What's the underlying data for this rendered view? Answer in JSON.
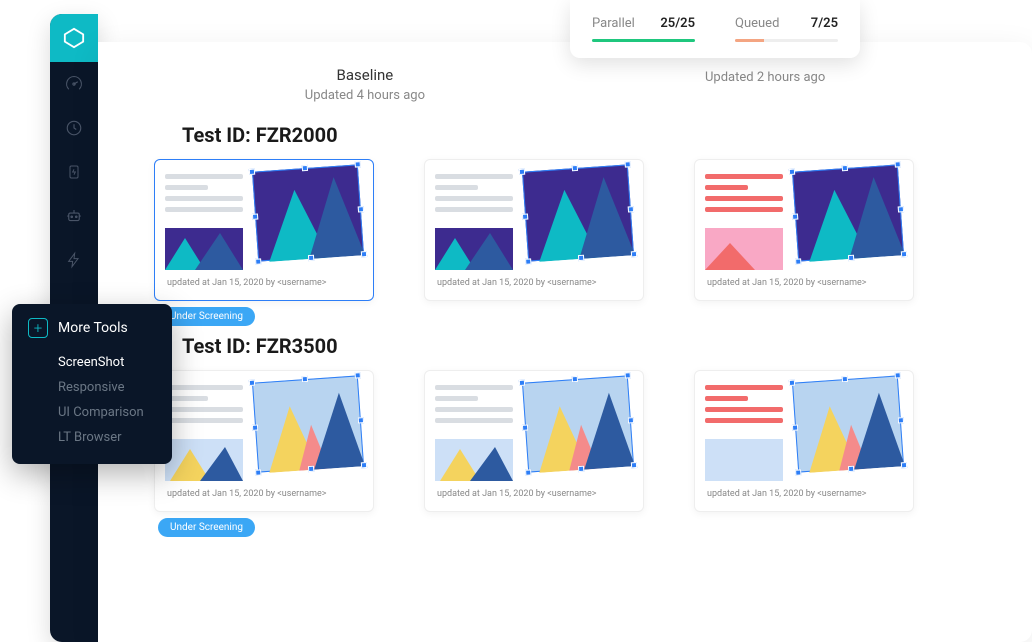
{
  "header": {
    "baseline": {
      "title": "Baseline",
      "subtitle": "Updated 4 hours ago"
    },
    "compare": {
      "subtitle": "Updated 2 hours ago"
    }
  },
  "status": {
    "parallel": {
      "label": "Parallel",
      "value": "25/25"
    },
    "queued": {
      "label": "Queued",
      "value": "7/25"
    }
  },
  "tests": [
    {
      "id": "FZR2000",
      "title": "Test ID: FZR2000",
      "badge": "Under Screening",
      "cards": [
        {
          "footer": "updated at Jan 15, 2020 by <username>",
          "selected": true,
          "variant": "dark_purple"
        },
        {
          "footer": "updated at Jan 15, 2020 by <username>",
          "selected": false,
          "variant": "dark_purple"
        },
        {
          "footer": "updated at Jan 15, 2020 by <username>",
          "selected": false,
          "variant": "red_pink"
        }
      ]
    },
    {
      "id": "FZR3500",
      "title": "Test ID: FZR3500",
      "badge": "Under Screening",
      "cards": [
        {
          "footer": "updated at Jan 15, 2020 by <username>",
          "selected": false,
          "variant": "light"
        },
        {
          "footer": "updated at Jan 15, 2020 by <username>",
          "selected": false,
          "variant": "light"
        },
        {
          "footer": "updated at Jan 15, 2020 by <username>",
          "selected": false,
          "variant": "red_light"
        }
      ]
    }
  ],
  "menu": {
    "title": "More Tools",
    "items": [
      "ScreenShot",
      "Responsive",
      "UI Comparison",
      "LT Browser"
    ],
    "active": 0
  },
  "sidebar_icons": [
    "dashboard-icon",
    "clock-icon",
    "battery-icon",
    "robot-icon",
    "bolt-icon"
  ]
}
